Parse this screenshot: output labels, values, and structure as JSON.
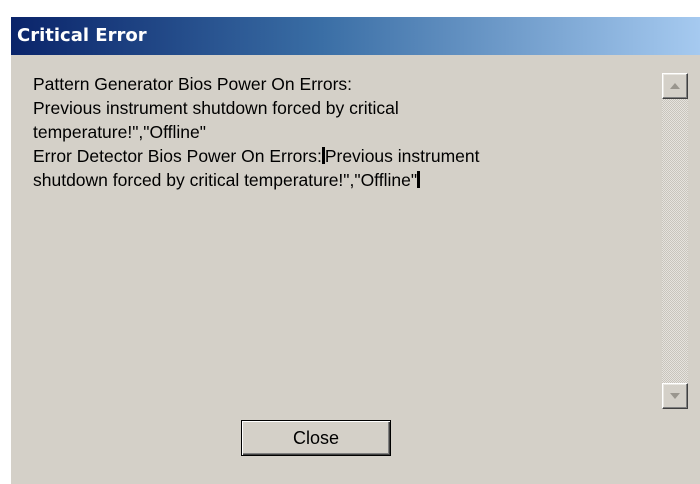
{
  "dialog": {
    "title": "Critical Error",
    "message_lines": [
      "Pattern Generator Bios Power On Errors:",
      "Previous instrument shutdown forced by critical",
      "temperature!\",\"Offline\"",
      "Error Detector Bios Power On Errors:",
      "Previous instrument",
      "shutdown forced by critical temperature!\",\"Offline\""
    ],
    "close_label": "Close"
  },
  "scrollbar": {
    "up_icon": "arrow-up-icon",
    "down_icon": "arrow-down-icon"
  },
  "colors": {
    "title_gradient_start": "#0a246a",
    "title_gradient_end": "#a6caf0",
    "face": "#d4d0c8"
  }
}
